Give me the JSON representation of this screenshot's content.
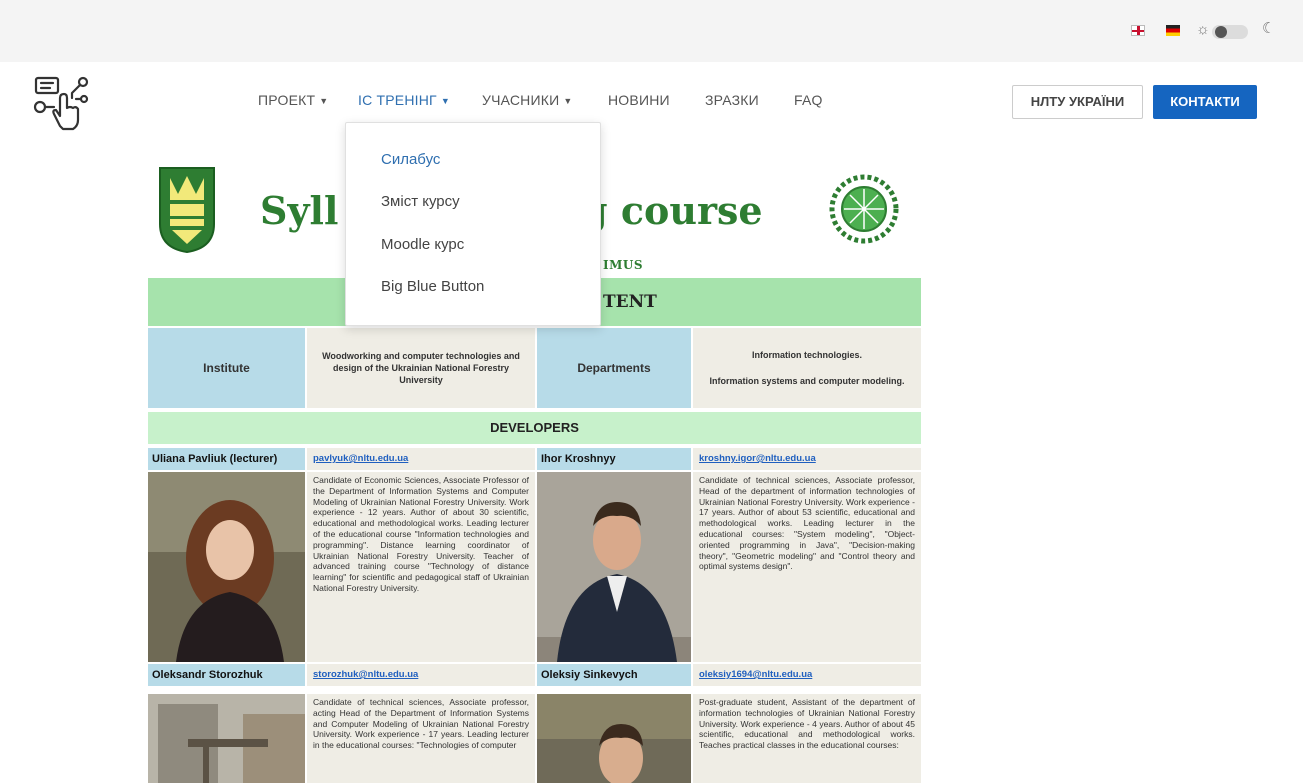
{
  "topbar": {
    "flags": [
      "gb-flag-icon",
      "de-flag-icon"
    ],
    "theme_icons": [
      "sun-icon",
      "moon-icon"
    ]
  },
  "logo": {
    "icon": "hand-pointer-circuit-icon"
  },
  "nav": {
    "items": [
      {
        "label": "ПРОЕКТ",
        "has_dropdown": true
      },
      {
        "label": "ІС ТРЕНІНГ",
        "has_dropdown": true,
        "active": true
      },
      {
        "label": "УЧАСНИКИ",
        "has_dropdown": true
      },
      {
        "label": "НОВИНИ",
        "has_dropdown": false
      },
      {
        "label": "ЗРАЗКИ",
        "has_dropdown": false
      },
      {
        "label": "FAQ",
        "has_dropdown": false
      }
    ],
    "buttons": {
      "nltu": "НЛТУ УКРАЇНИ",
      "contacts": "КОНТАКТИ"
    }
  },
  "dropdown": {
    "items": [
      "Силабус",
      "Зміст курсу",
      "Moodle курс",
      "Big Blue Button"
    ]
  },
  "doc": {
    "heading_left": "Syll",
    "heading_right": "ng course",
    "subtag": "IMUS",
    "content_band": "TENT",
    "institute_label": "Institute",
    "institute_value": "Woodworking and computer technologies and design of the Ukrainian National Forestry University",
    "departments_label": "Departments",
    "departments_value_1": "Information technologies.",
    "departments_value_2": "Information systems and computer modeling.",
    "developers_band": "DEVELOPERS",
    "developers": [
      {
        "name": "Uliana Pavliuk (lecturer)",
        "email": "pavlyuk@nltu.edu.ua",
        "bio": "Candidate of Economic Sciences, Associate Professor of the Department of Information Systems and Computer Modeling of Ukrainian National Forestry University. Work experience - 12 years. Author of about 30 scientific, educational and methodological works. Leading lecturer of the educational course \"Information technologies and programming\". Distance learning coordinator of Ukrainian National Forestry University. Teacher of advanced training course \"Technology of distance learning\" for scientific and pedagogical staff of Ukrainian National Forestry University."
      },
      {
        "name": "Ihor Kroshnyy",
        "email": "kroshny.igor@nltu.edu.ua",
        "bio": "Candidate of technical sciences, Associate professor, Head of the department of information technologies of Ukrainian National Forestry University. Work experience - 17 years. Author of about 53 scientific, educational and methodological works. Leading lecturer in the educational courses: \"System modeling\", \"Object-oriented programming in Java\", \"Decision-making theory\", \"Geometric modeling\" and \"Control theory and optimal systems design\"."
      },
      {
        "name": "Oleksandr Storozhuk",
        "email": "storozhuk@nltu.edu.ua",
        "bio": "Candidate of technical sciences, Associate professor, acting Head of the Department of Information Systems and Computer Modeling of Ukrainian National Forestry University. Work experience - 17 years. Leading lecturer in the educational courses: \"Technologies of computer"
      },
      {
        "name": "Oleksiy Sinkevych",
        "email": "oleksiy1694@nltu.edu.ua",
        "bio": "Post-graduate student, Assistant of the department of information technologies of Ukrainian National Forestry University. Work experience - 4 years. Author of about 45 scientific, educational and methodological works. Teaches practical classes in the educational courses:"
      }
    ]
  }
}
